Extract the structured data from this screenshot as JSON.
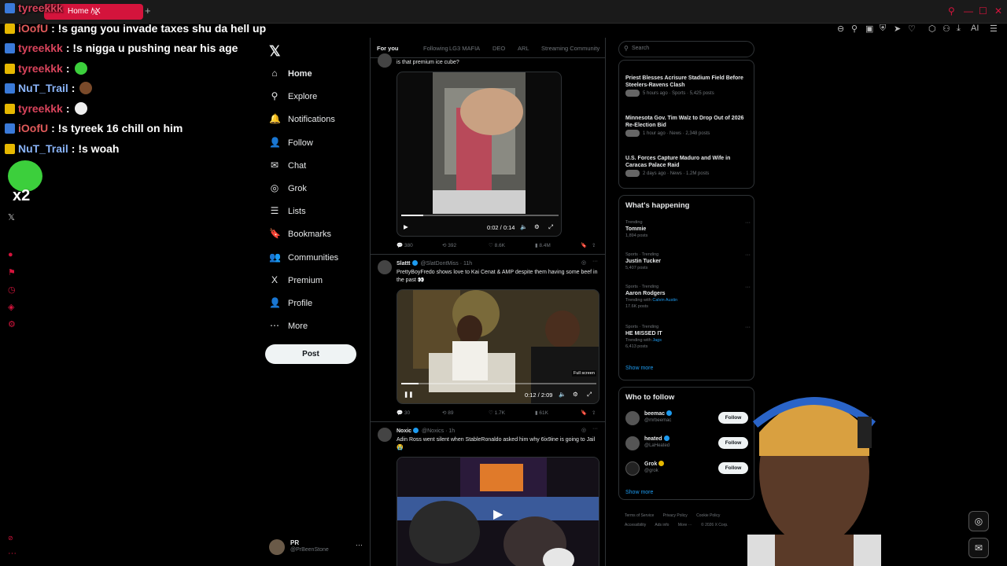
{
  "browser": {
    "tab_title": "Home / X",
    "new_tab": "+",
    "ai_label": "AI",
    "accent": "#d4143c"
  },
  "chat": {
    "messages": [
      {
        "user": "tyreekkk",
        "color": "#d9445c",
        "msg": "",
        "emote": ""
      },
      {
        "user": "iOofU",
        "color": "#e05a5a",
        "msg": ": !s gang you invade taxes shu da hell up",
        "emote": ""
      },
      {
        "user": "tyreekkk",
        "color": "#d9445c",
        "msg": ": !s nigga u pushing near his age",
        "emote": ""
      },
      {
        "user": "tyreekkk",
        "color": "#d9445c",
        "msg": ":",
        "emote": "green"
      },
      {
        "user": "NuT_Trail",
        "color": "#8ab4f8",
        "msg": ":",
        "emote": "brown"
      },
      {
        "user": "tyreekkk",
        "color": "#d9445c",
        "msg": ":",
        "emote": "white"
      },
      {
        "user": "iOofU",
        "color": "#e05a5a",
        "msg": ": !s tyreek 16 chill on him",
        "emote": ""
      },
      {
        "user": "NuT_Trail",
        "color": "#8ab4f8",
        "msg": ": !s woah",
        "emote": ""
      }
    ],
    "big_emote_count": "x2"
  },
  "nav": {
    "items": [
      {
        "label": "Home",
        "icon": "home-icon",
        "glyph": "⌂"
      },
      {
        "label": "Explore",
        "icon": "search-icon",
        "glyph": "⚲"
      },
      {
        "label": "Notifications",
        "icon": "bell-icon",
        "glyph": "🔔"
      },
      {
        "label": "Follow",
        "icon": "follow-icon",
        "glyph": "👤"
      },
      {
        "label": "Chat",
        "icon": "mail-icon",
        "glyph": "✉"
      },
      {
        "label": "Grok",
        "icon": "grok-icon",
        "glyph": "◎"
      },
      {
        "label": "Lists",
        "icon": "list-icon",
        "glyph": "☰"
      },
      {
        "label": "Bookmarks",
        "icon": "bookmark-icon",
        "glyph": "🔖"
      },
      {
        "label": "Communities",
        "icon": "communities-icon",
        "glyph": "👥"
      },
      {
        "label": "Premium",
        "icon": "x-icon",
        "glyph": "X"
      },
      {
        "label": "Profile",
        "icon": "profile-icon",
        "glyph": "👤"
      },
      {
        "label": "More",
        "icon": "more-icon",
        "glyph": "⋯"
      }
    ],
    "post_label": "Post",
    "profile": {
      "name": "PR",
      "handle": "@PrBeenStone",
      "more": "···"
    }
  },
  "timeline": {
    "tabs": [
      "For you",
      "Following",
      "LG3 MAFIA",
      "DEO",
      "ARL",
      "Streaming Community"
    ],
    "tweet1": {
      "text": "is that premium ice cube?",
      "time": "0:02 / 0:14",
      "progress": 0.14,
      "replies": "380",
      "reposts": "392",
      "likes": "8.6K",
      "views": "8.4M"
    },
    "tweet2": {
      "name": "Slattt",
      "handle": "@SlatDontMiss · 11h",
      "text": "PrettyBoyFredo shows love to Kai Cenat & AMP despite them having some beef in the past 👀",
      "time": "0:12 / 2:09",
      "progress": 0.09,
      "tooltip": "Full screen",
      "replies": "30",
      "reposts": "89",
      "likes": "1.7K",
      "views": "61K"
    },
    "tweet3": {
      "name": "Noxic",
      "handle": "@Noxics · 1h",
      "text": "Adin Ross went silent when StableRonaldo asked him why 6ix9ine is going to Jail😭"
    }
  },
  "right": {
    "search_placeholder": "Search",
    "news": [
      {
        "title": "Priest Blesses Acrisure Stadium Field Before Steelers-Ravens Clash",
        "meta": "5 hours ago · Sports · 5,425 posts"
      },
      {
        "title": "Minnesota Gov. Tim Walz to Drop Out of 2026 Re-Election Bid",
        "meta": "1 hour ago · News · 2,348 posts"
      },
      {
        "title": "U.S. Forces Capture Maduro and Wife in Caracas Palace Raid",
        "meta": "2 days ago · News · 1.2M posts"
      }
    ],
    "whats_happening": "What's happening",
    "trends": [
      {
        "category": "Trending",
        "name": "Tommie",
        "with": "",
        "with_name": "",
        "posts": "1,894 posts"
      },
      {
        "category": "Sports · Trending",
        "name": "Justin Tucker",
        "with": "",
        "with_name": "",
        "posts": "5,407 posts"
      },
      {
        "category": "Sports · Trending",
        "name": "Aaron Rodgers",
        "with": "Trending with",
        "with_name": "Calvin Austin",
        "posts": "17.6K posts"
      },
      {
        "category": "Sports · Trending",
        "name": "HE MISSED IT",
        "with": "Trending with",
        "with_name": "Jags",
        "posts": "6,413 posts"
      }
    ],
    "show_more": "Show more",
    "who_to_follow": "Who to follow",
    "follow_suggestions": [
      {
        "name": "beemac",
        "handle": "@mrbeemac",
        "button": "Follow"
      },
      {
        "name": "heated",
        "handle": "@LaHeated",
        "button": "Follow"
      },
      {
        "name": "Grok",
        "handle": "@grok",
        "button": "Follow"
      }
    ],
    "footer": [
      "Terms of Service",
      "Privacy Policy",
      "Cookie Policy",
      "Accessibility",
      "Ads info",
      "More ···",
      "© 2026 X Corp."
    ]
  }
}
